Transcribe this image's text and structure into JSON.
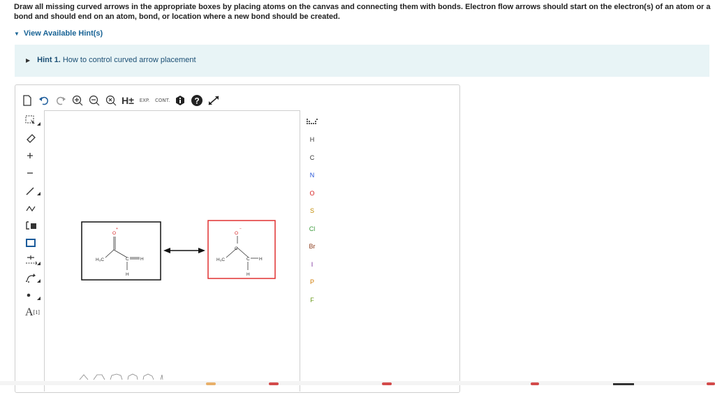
{
  "instructions": "Draw all missing curved arrows in the appropriate boxes by placing atoms on the canvas and connecting them with bonds. Electron flow arrows should start on the electron(s) of an atom or a bond and should end on an atom, bond, or location where a new bond should be created.",
  "hints": {
    "toggle_label": "View Available Hint(s)",
    "items": [
      {
        "number": "Hint 1.",
        "text": "How to control curved arrow placement"
      }
    ]
  },
  "toolbar": {
    "h_label": "H±",
    "exp_label": "EXP.",
    "cont_label": "CONT."
  },
  "left_tools": {
    "text_label": "A",
    "text_sup": "[1]"
  },
  "atoms": [
    {
      "symbol": "H",
      "color": "#333333"
    },
    {
      "symbol": "C",
      "color": "#333333"
    },
    {
      "symbol": "N",
      "color": "#1f4fd6"
    },
    {
      "symbol": "O",
      "color": "#d62020"
    },
    {
      "symbol": "S",
      "color": "#c08a00"
    },
    {
      "symbol": "Cl",
      "color": "#3a9a3a"
    },
    {
      "symbol": "Br",
      "color": "#8a3a1a"
    },
    {
      "symbol": "I",
      "color": "#7a2a9a"
    },
    {
      "symbol": "P",
      "color": "#d07a00"
    },
    {
      "symbol": "F",
      "color": "#6a9a1a"
    }
  ],
  "molecules": {
    "left": {
      "ch3": "H₃C",
      "c": "C",
      "h": "H",
      "bottom_h": "H",
      "o": "O",
      "o_charge": "+"
    },
    "right": {
      "ch3": "H₃C",
      "c_top": "C",
      "c": "C",
      "h": "H",
      "bottom_h": "H",
      "o": "O",
      "o_charge": "−"
    }
  },
  "colors": {
    "accent": "#1a6496",
    "hint_bg": "#e8f4f6",
    "box_red": "#e03030",
    "box_black": "#111111"
  }
}
